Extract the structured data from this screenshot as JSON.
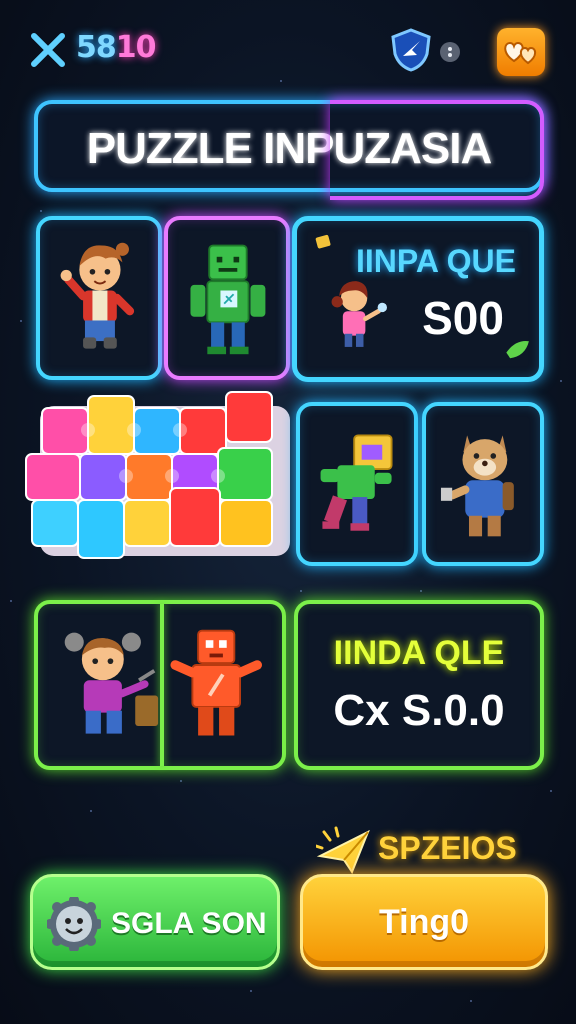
{
  "header": {
    "score_part1": "58",
    "score_part2": "10",
    "close_icon": "x-icon",
    "shield_icon": "shield-icon",
    "menu_icon": "dots-icon",
    "hearts_icon": "hearts-icon"
  },
  "title": "PUZZLE INPUZASIA",
  "offers": [
    {
      "title": "IINPA QUE",
      "price": "S00"
    },
    {
      "title": "IINDA QLE",
      "price": "Cx S.0.0"
    }
  ],
  "bottom": {
    "left_button": "SGLA SON",
    "right_button": "Ting0",
    "right_label": "SPZEIOS"
  },
  "colors": {
    "cyan": "#44d6ff",
    "pink": "#e97bff",
    "green": "#7cf04a",
    "offer1_title": "#58d8ff",
    "offer2_title": "#e4ff3a",
    "yellow_button": "#ffc21f",
    "green_button": "#4bd94e"
  }
}
